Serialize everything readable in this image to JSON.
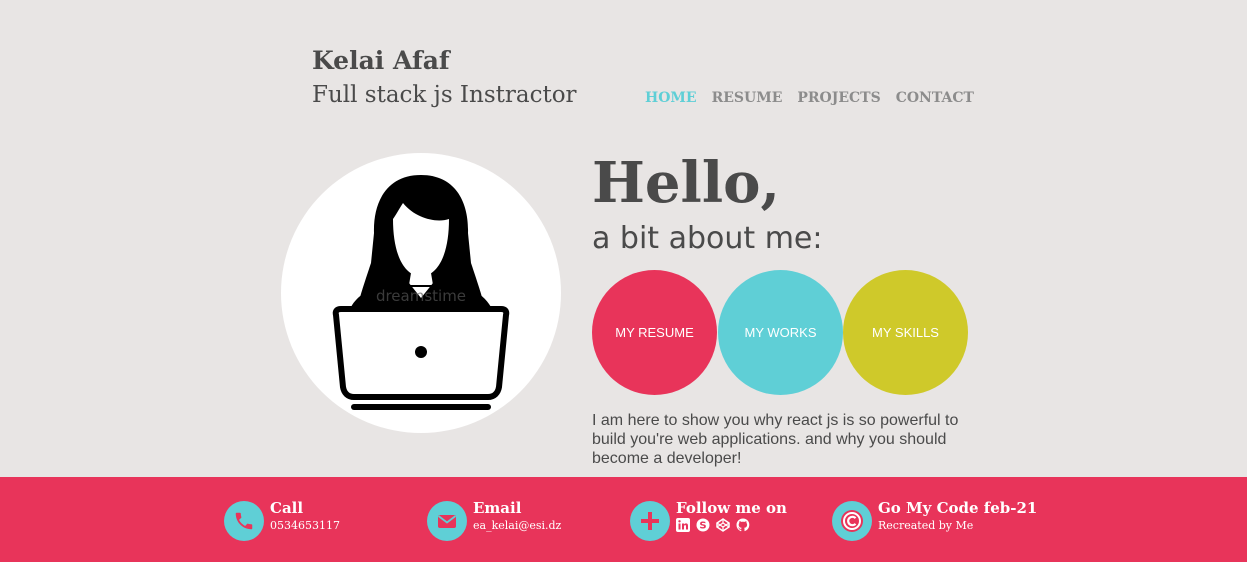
{
  "header": {
    "name": "Kelai Afaf",
    "role": "Full stack js Instractor"
  },
  "nav": {
    "items": [
      {
        "label": "HOME",
        "active": true
      },
      {
        "label": "RESUME",
        "active": false
      },
      {
        "label": "PROJECTS",
        "active": false
      },
      {
        "label": "CONTACT",
        "active": false
      }
    ]
  },
  "hero": {
    "greeting": "Hello,",
    "subtitle": "a bit about me:",
    "avatar_watermark": "dreamstime",
    "buttons": [
      {
        "label": "MY RESUME",
        "color": "#e8345a"
      },
      {
        "label": "MY WORKS",
        "color": "#5fcfd6"
      },
      {
        "label": "MY SKILLS",
        "color": "#cfc92a"
      }
    ],
    "bio": "I am here to show you why react js is so powerful to build you're web applications. and why you should become a developer!"
  },
  "footer": {
    "call": {
      "title": "Call",
      "value": "0534653117",
      "icon": "phone-icon"
    },
    "email": {
      "title": "Email",
      "value": "ea_kelai@esi.dz",
      "icon": "envelope-icon"
    },
    "follow": {
      "title": "Follow me on",
      "icon": "plus-icon",
      "networks": [
        "linkedin-icon",
        "skype-icon",
        "codepen-icon",
        "github-icon"
      ]
    },
    "credit": {
      "title": "Go My Code feb-21",
      "value": "Recreated by Me",
      "icon": "copyright-icon"
    }
  },
  "colors": {
    "accent_red": "#e8345a",
    "accent_cyan": "#5fcfd6",
    "accent_olive": "#cfc92a",
    "background": "#e8e5e4",
    "text": "#4a4a4a"
  }
}
